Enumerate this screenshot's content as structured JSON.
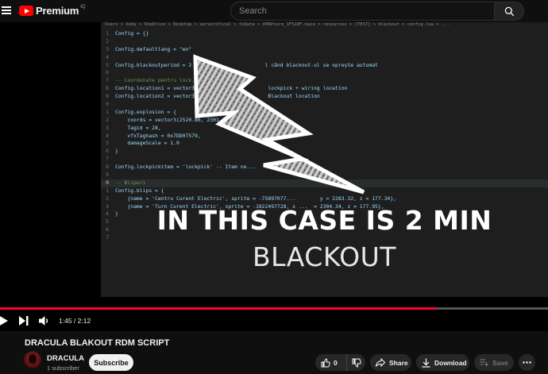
{
  "header": {
    "logo_text": "Premium",
    "logo_region": "IQ",
    "search_placeholder": "Search"
  },
  "editor": {
    "breadcrumb": "Users > koby > OneDrive > Desktop > serverofical > txData > VORPcore_1F52DF.base > resources > [TEST] > blackout > config.lua > ...",
    "lines": [
      {
        "n": "1",
        "text": "Config = {}"
      },
      {
        "n": "2",
        "text": ""
      },
      {
        "n": "3",
        "text": "Config.defaultlang = \"en\""
      },
      {
        "n": "4",
        "text": ""
      },
      {
        "n": "5",
        "text": "Config.blackoutperiod = 2 -- ...                 l când blackout-ul se oprește automat"
      },
      {
        "n": "6",
        "text": ""
      },
      {
        "n": "7",
        "text": "-- Coordonate pentru lock..."
      },
      {
        "n": "8",
        "text": "Config.location1 = vector3(                       lockpick + wiring location"
      },
      {
        "n": "9",
        "text": "Config.location2 = vector3(                       Blackout location"
      },
      {
        "n": "0",
        "text": ""
      },
      {
        "n": "1",
        "text": "Config.explosion = {"
      },
      {
        "n": "2",
        "text": "    coords = vector3(2520.86, 2301.26, 196.9..."
      },
      {
        "n": "3",
        "text": "    Tagid = 28,"
      },
      {
        "n": "4",
        "text": "    vfxTaghash = 0x7DD07579,"
      },
      {
        "n": "5",
        "text": "    damageScale = 1.0"
      },
      {
        "n": "6",
        "text": "}"
      },
      {
        "n": "7",
        "text": ""
      },
      {
        "n": "8",
        "text": "Config.lockpickitem = 'lockpick' -- Item ne..."
      },
      {
        "n": "9",
        "text": ""
      },
      {
        "n": "0",
        "text": "-- Blipuri"
      },
      {
        "n": "1",
        "text": "Config.blips = {"
      },
      {
        "n": "2",
        "text": "    {name = 'Centru Curent Electric', sprite = -75897077...        y = 2283.32, z = 177.34},"
      },
      {
        "n": "3",
        "text": "    {name = 'Turn Curent Electric', sprite = -1822497728, x ...  = 2304.34, z = 177.95},"
      },
      {
        "n": "4",
        "text": "}"
      },
      {
        "n": "5",
        "text": ""
      },
      {
        "n": "6",
        "text": ""
      },
      {
        "n": "7",
        "text": ""
      }
    ]
  },
  "overlay": {
    "line1": "IN THIS CASE IS 2 MIN",
    "line2": "BLACKOUT"
  },
  "player": {
    "time": "1:45 / 2:12",
    "progress": 0.795
  },
  "video": {
    "title": "DRACULA BLAKOUT RDM SCRIPT"
  },
  "channel": {
    "name": "DRACULA",
    "subscribers": "1 subscriber",
    "subscribe_label": "Subscribe"
  },
  "actions": {
    "likes": "0",
    "share_label": "Share",
    "download_label": "Download",
    "save_label": "Save"
  }
}
